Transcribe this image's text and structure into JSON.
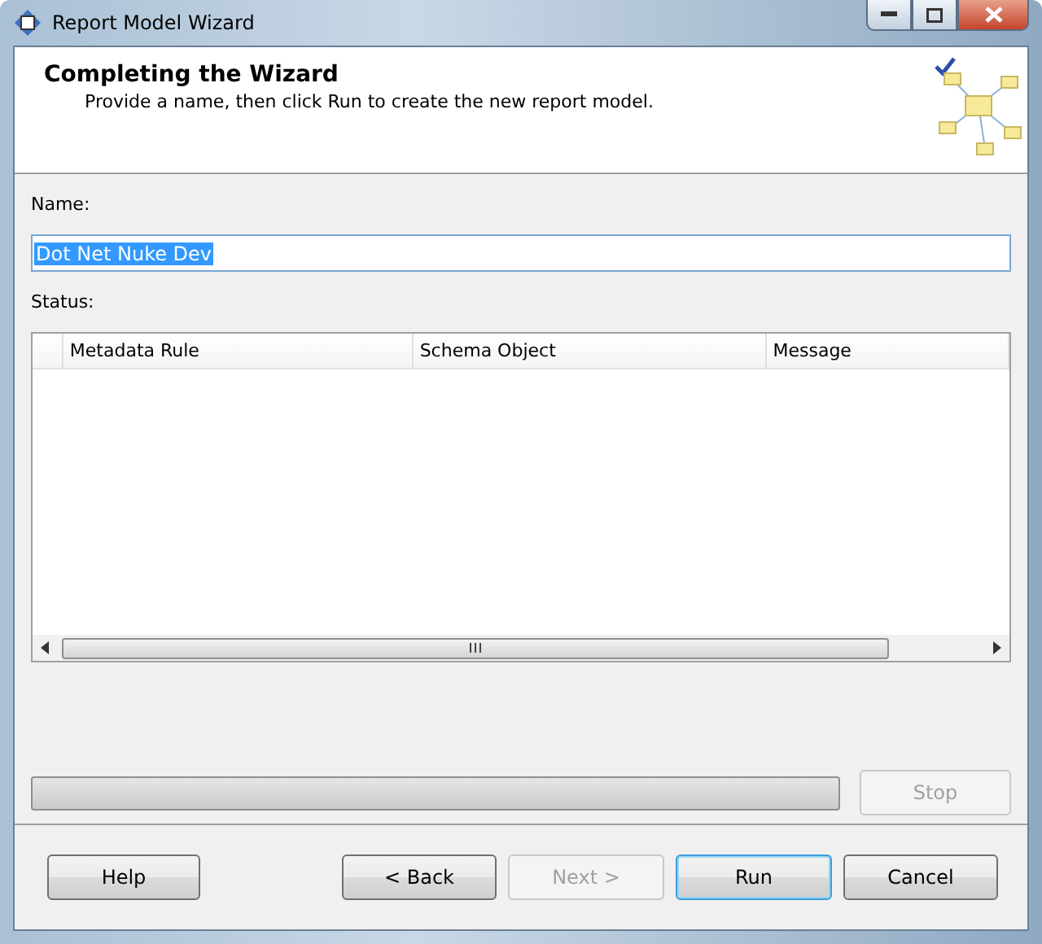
{
  "window": {
    "title": "Report Model Wizard"
  },
  "header": {
    "title": "Completing the Wizard",
    "subtitle": "Provide a name, then click Run to create the new report model."
  },
  "name_field": {
    "label": "Name:",
    "value": "Dot Net Nuke Dev",
    "selected": true
  },
  "status": {
    "label": "Status:",
    "columns": [
      "Metadata Rule",
      "Schema Object",
      "Message"
    ]
  },
  "progress": {
    "level": 0
  },
  "stop_button": {
    "label": "Stop",
    "disabled": true
  },
  "buttons": [
    {
      "label": "Help",
      "disabled": false,
      "default": false
    },
    {
      "label": "< Back",
      "disabled": false,
      "default": false
    },
    {
      "label": "Next >",
      "disabled": true,
      "default": false
    },
    {
      "label": "Run",
      "disabled": false,
      "default": true
    },
    {
      "label": "Cancel",
      "disabled": false,
      "default": false
    }
  ]
}
